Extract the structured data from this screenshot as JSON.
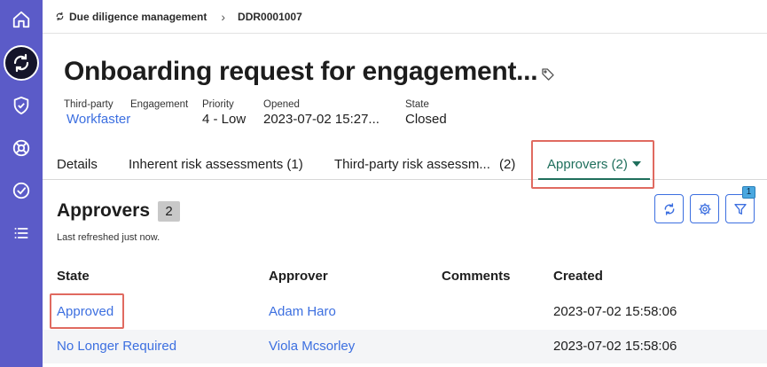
{
  "rail": {
    "items": [
      {
        "icon": "home-icon"
      },
      {
        "icon": "sync-icon",
        "active": true
      },
      {
        "icon": "shield-check-icon"
      },
      {
        "icon": "lifebuoy-icon"
      },
      {
        "icon": "check-circle-icon"
      },
      {
        "icon": "list-icon"
      }
    ]
  },
  "breadcrumb": {
    "parent": "Due diligence management",
    "current": "DDR0001007"
  },
  "record": {
    "title": "Onboarding request for engagement...",
    "fields": {
      "third_party_label": "Third-party",
      "third_party_value": "Workfaster",
      "engagement_label": "Engagement",
      "priority_label": "Priority",
      "priority_value": "4 - Low",
      "opened_label": "Opened",
      "opened_value": "2023-07-02 15:27...",
      "state_label": "State",
      "state_value": "Closed"
    }
  },
  "tabs": {
    "details": "Details",
    "inherent": "Inherent risk assessments (1)",
    "thirdparty": "Third-party risk assessm...",
    "thirdparty_count": "(2)",
    "approvers": "Approvers (2)"
  },
  "approvers_list": {
    "title": "Approvers",
    "count": "2",
    "refreshed": "Last refreshed just now.",
    "filter_count": "1",
    "columns": {
      "state": "State",
      "approver": "Approver",
      "comments": "Comments",
      "created": "Created"
    },
    "rows": [
      {
        "state": "Approved",
        "approver": "Adam Haro",
        "comments": "",
        "created": "2023-07-02 15:58:06"
      },
      {
        "state": "No Longer Required",
        "approver": "Viola Mcsorley",
        "comments": "",
        "created": "2023-07-02 15:58:06"
      }
    ]
  },
  "colors": {
    "rail": "#5b5bc8",
    "link": "#3c6fe0",
    "active_tab": "#1f6f5c",
    "highlight": "#e06a60"
  }
}
